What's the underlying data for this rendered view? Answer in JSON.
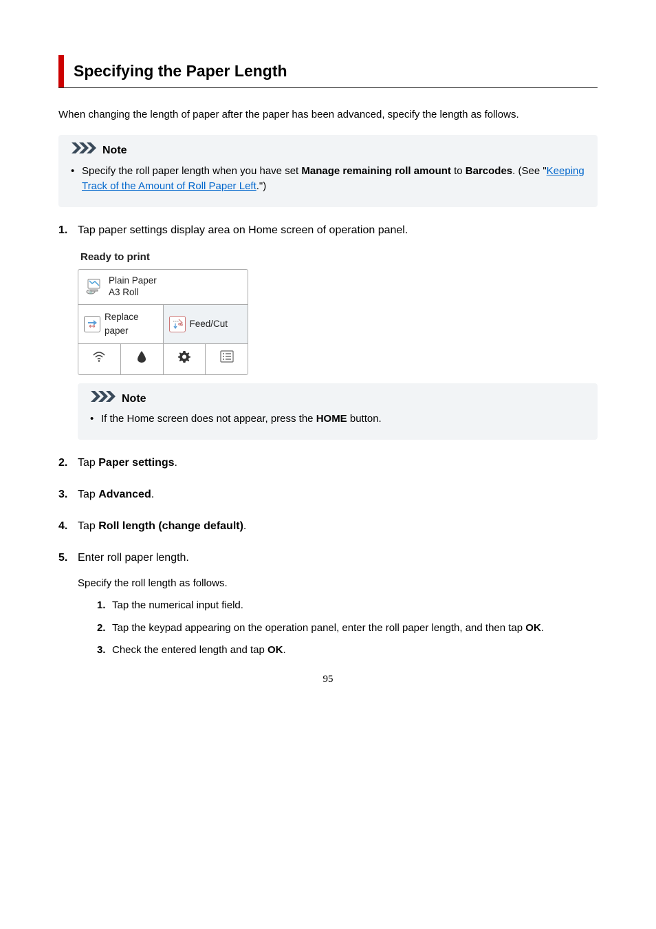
{
  "title": "Specifying the Paper Length",
  "intro": "When changing the length of paper after the paper has been advanced, specify the length as follows.",
  "note1": {
    "label": "Note",
    "pre": "Specify the roll paper length when you have set ",
    "bold1": "Manage remaining roll amount",
    "mid": " to ",
    "bold2": "Barcodes",
    "post1": ". (See \"",
    "link": "Keeping Track of the Amount of Roll Paper Left",
    "post2": ".\")"
  },
  "step1": {
    "text": "Tap paper settings display area on Home screen of operation panel.",
    "ss": {
      "ready": "Ready to print",
      "paper_type": "Plain Paper",
      "paper_size": "A3 Roll",
      "replace": "Replace paper",
      "feedcut": "Feed/Cut"
    },
    "note": {
      "label": "Note",
      "pre": "If the Home screen does not appear, press the ",
      "bold": "HOME",
      "post": " button."
    }
  },
  "step2": {
    "pre": "Tap ",
    "bold": "Paper settings",
    "post": "."
  },
  "step3": {
    "pre": "Tap ",
    "bold": "Advanced",
    "post": "."
  },
  "step4": {
    "pre": "Tap ",
    "bold": "Roll length (change default)",
    "post": "."
  },
  "step5": {
    "text": "Enter roll paper length.",
    "sub": "Specify the roll length as follows.",
    "s1": "Tap the numerical input field.",
    "s2": {
      "pre": "Tap the keypad appearing on the operation panel, enter the roll paper length, and then tap ",
      "bold": "OK",
      "post": "."
    },
    "s3": {
      "pre": "Check the entered length and tap ",
      "bold": "OK",
      "post": "."
    }
  },
  "page_number": "95"
}
